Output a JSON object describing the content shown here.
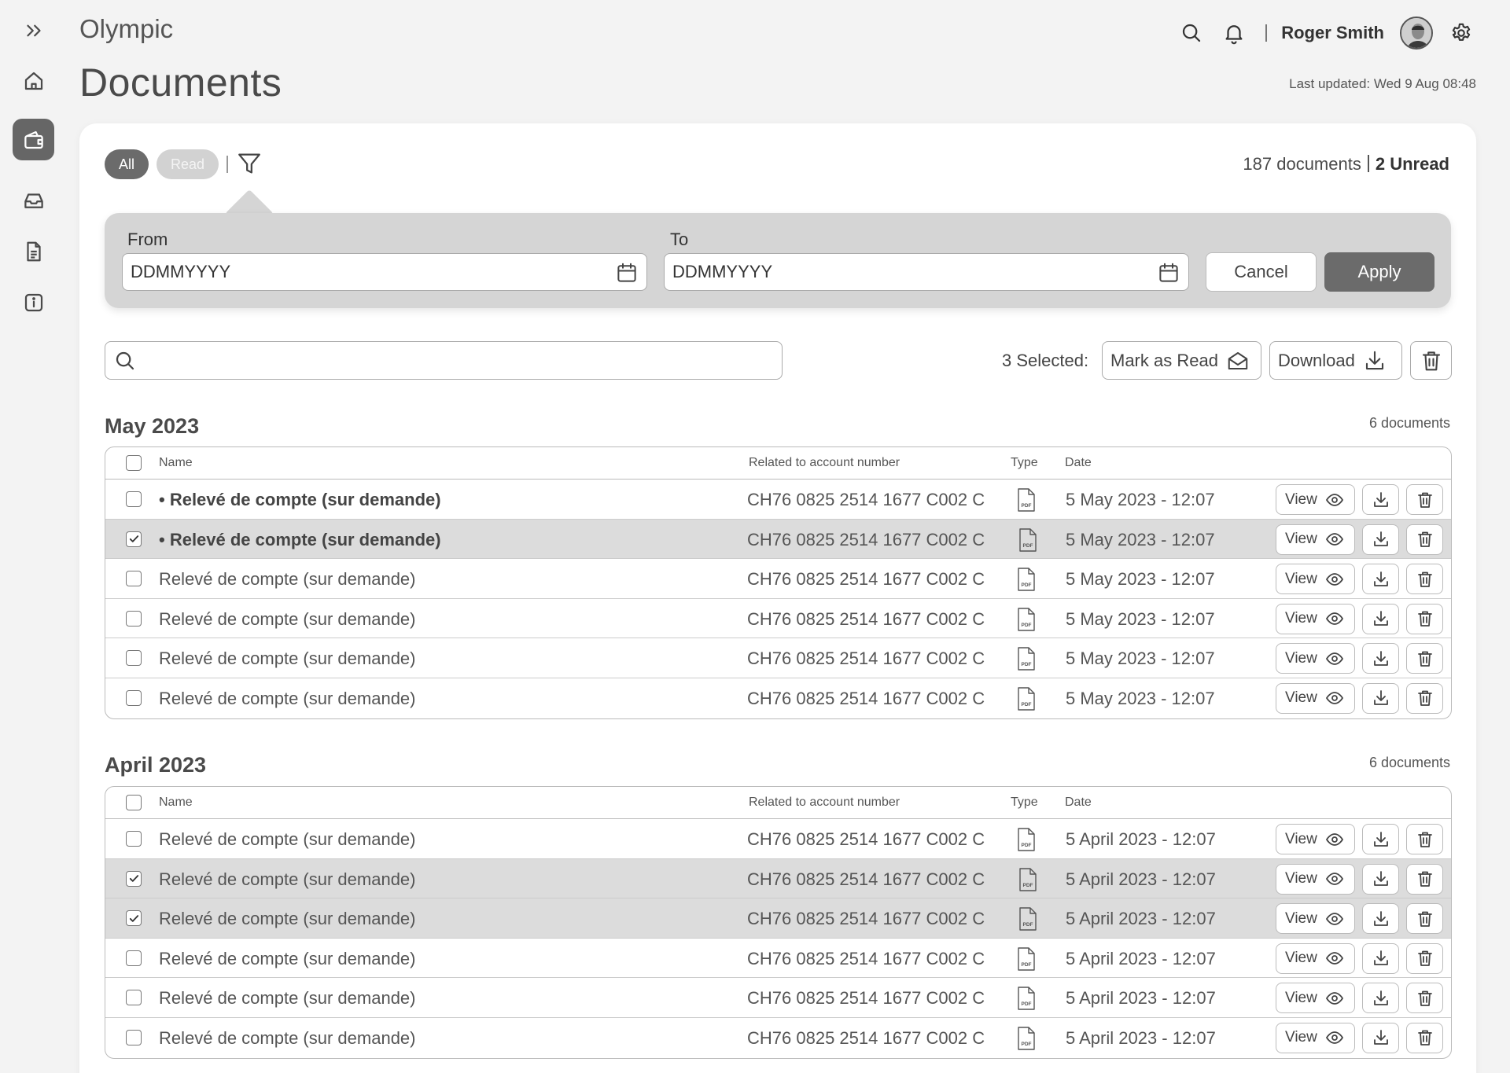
{
  "header": {
    "brand": "Olympic",
    "title": "Documents",
    "last_updated": "Last updated: Wed 9 Aug 08:48",
    "user_name": "Roger Smith"
  },
  "sidebar": {
    "items": [
      {
        "icon": "chevrons-right-icon"
      },
      {
        "icon": "home-icon"
      },
      {
        "icon": "wallet-icon",
        "active": true
      },
      {
        "icon": "inbox-icon"
      },
      {
        "icon": "document-icon"
      },
      {
        "icon": "info-icon"
      }
    ]
  },
  "filters": {
    "all_label": "All",
    "read_label": "Read",
    "doc_count": "187 documents",
    "unread": "2 Unread"
  },
  "date_filter": {
    "from_label": "From",
    "from_value": "DDMMYYYY",
    "to_label": "To",
    "to_value": "DDMMYYYY",
    "cancel_label": "Cancel",
    "apply_label": "Apply"
  },
  "search": {
    "value": ""
  },
  "bulk": {
    "selected_label": "3 Selected:",
    "mark_read_label": "Mark as Read",
    "download_label": "Download"
  },
  "columns": {
    "name": "Name",
    "account": "Related to account number",
    "type": "Type",
    "date": "Date"
  },
  "actions": {
    "view_label": "View"
  },
  "colors": {
    "accent": "#6b6b6b",
    "selected_row": "#dcdcdc",
    "panel": "#d5d5d5",
    "background": "#f3f3f3"
  },
  "groups": [
    {
      "title": "May 2023",
      "count": "6 documents",
      "rows": [
        {
          "name": "• Relevé de compte (sur demande)",
          "account": "CH76 0825 2514 1677 C002 C",
          "type": "PDF",
          "date": "5 May 2023 - 12:07",
          "unread": true,
          "selected": false
        },
        {
          "name": "• Relevé de compte (sur demande)",
          "account": "CH76 0825 2514 1677 C002 C",
          "type": "PDF",
          "date": "5 May 2023 - 12:07",
          "unread": true,
          "selected": true
        },
        {
          "name": "Relevé de compte (sur demande)",
          "account": "CH76 0825 2514 1677 C002 C",
          "type": "PDF",
          "date": "5 May 2023 - 12:07",
          "unread": false,
          "selected": false
        },
        {
          "name": "Relevé de compte (sur demande)",
          "account": "CH76 0825 2514 1677 C002 C",
          "type": "PDF",
          "date": "5 May 2023 - 12:07",
          "unread": false,
          "selected": false
        },
        {
          "name": "Relevé de compte (sur demande)",
          "account": "CH76 0825 2514 1677 C002 C",
          "type": "PDF",
          "date": "5 May 2023 - 12:07",
          "unread": false,
          "selected": false
        },
        {
          "name": "Relevé de compte (sur demande)",
          "account": "CH76 0825 2514 1677 C002 C",
          "type": "PDF",
          "date": "5 May 2023 - 12:07",
          "unread": false,
          "selected": false
        }
      ]
    },
    {
      "title": "April 2023",
      "count": "6 documents",
      "rows": [
        {
          "name": "Relevé de compte (sur demande)",
          "account": "CH76 0825 2514 1677 C002 C",
          "type": "PDF",
          "date": "5 April 2023 - 12:07",
          "unread": false,
          "selected": false
        },
        {
          "name": "Relevé de compte (sur demande)",
          "account": "CH76 0825 2514 1677 C002 C",
          "type": "PDF",
          "date": "5 April 2023 - 12:07",
          "unread": false,
          "selected": true
        },
        {
          "name": "Relevé de compte (sur demande)",
          "account": "CH76 0825 2514 1677 C002 C",
          "type": "PDF",
          "date": "5 April 2023 - 12:07",
          "unread": false,
          "selected": true
        },
        {
          "name": "Relevé de compte (sur demande)",
          "account": "CH76 0825 2514 1677 C002 C",
          "type": "PDF",
          "date": "5 April 2023 - 12:07",
          "unread": false,
          "selected": false
        },
        {
          "name": "Relevé de compte (sur demande)",
          "account": "CH76 0825 2514 1677 C002 C",
          "type": "PDF",
          "date": "5 April 2023 - 12:07",
          "unread": false,
          "selected": false
        },
        {
          "name": "Relevé de compte (sur demande)",
          "account": "CH76 0825 2514 1677 C002 C",
          "type": "PDF",
          "date": "5 April 2023 - 12:07",
          "unread": false,
          "selected": false
        }
      ]
    }
  ]
}
